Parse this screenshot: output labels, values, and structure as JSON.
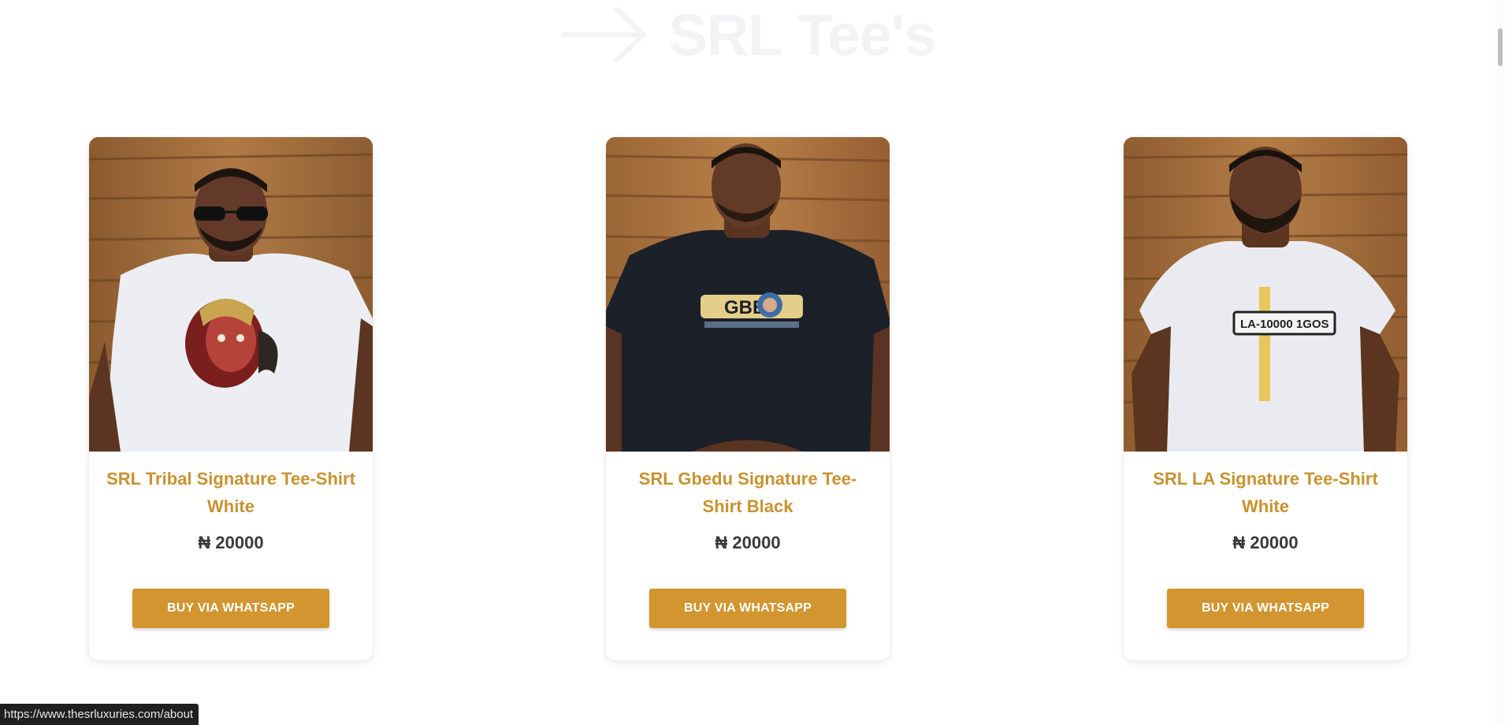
{
  "section": {
    "title": "SRL Tee's",
    "arrow_icon": "arrow-right-icon"
  },
  "products": [
    {
      "name": "SRL Tribal Signature Tee-Shirt White",
      "price": "₦ 20000",
      "button_label": "BUY VIA WHATSAPP",
      "shirt_color": "#eceef3",
      "graphic": "tribal-face-print"
    },
    {
      "name": "SRL Gbedu Signature Tee-Shirt Black",
      "price": "₦ 20000",
      "button_label": "BUY VIA WHATSAPP",
      "shirt_color": "#1c2028",
      "graphic": "gbedu-print"
    },
    {
      "name": "SRL LA Signature Tee-Shirt White",
      "price": "₦ 20000",
      "button_label": "BUY VIA WHATSAPP",
      "shirt_color": "#e9ebf1",
      "graphic": "license-plate-print",
      "graphic_text": "LA-10000 1GOS"
    }
  ],
  "status_bar": {
    "url": "https://www.thesrluxuries.com/about"
  },
  "colors": {
    "accent": "#d3952f",
    "product_name": "#c9922f",
    "price": "#3a3a3a",
    "heading_faded": "#f3f3f5"
  }
}
